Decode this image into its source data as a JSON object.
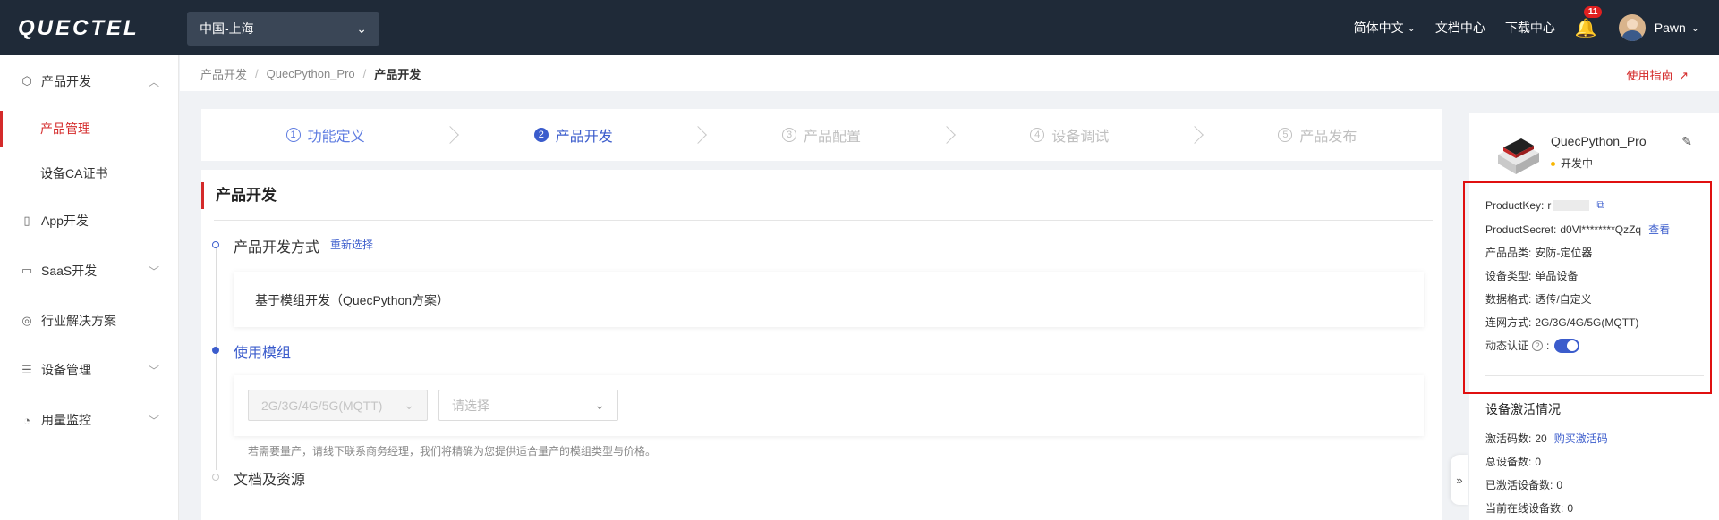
{
  "header": {
    "logo_text": "QUECTEL",
    "region": "中国-上海",
    "language": "简体中文",
    "docs": "文档中心",
    "downloads": "下载中心",
    "notification_count": "11",
    "user": "Pawn"
  },
  "sidebar": {
    "items": [
      {
        "label": "产品开发",
        "icon": "cube-icon"
      },
      {
        "label": "产品管理"
      },
      {
        "label": "设备CA证书"
      },
      {
        "label": "App开发",
        "icon": "phone-icon"
      },
      {
        "label": "SaaS开发",
        "icon": "monitor-icon"
      },
      {
        "label": "行业解决方案",
        "icon": "globe-icon"
      },
      {
        "label": "设备管理",
        "icon": "server-icon"
      },
      {
        "label": "用量监控",
        "icon": "chart-icon"
      }
    ]
  },
  "breadcrumb": {
    "items": [
      "产品开发",
      "QuecPython_Pro",
      "产品开发"
    ],
    "separator": "/",
    "guide": "使用指南"
  },
  "steps": [
    {
      "num": "1",
      "label": "功能定义"
    },
    {
      "num": "2",
      "label": "产品开发"
    },
    {
      "num": "3",
      "label": "产品配置"
    },
    {
      "num": "4",
      "label": "设备调试"
    },
    {
      "num": "5",
      "label": "产品发布"
    }
  ],
  "main": {
    "title": "产品开发",
    "dev_method_label": "产品开发方式",
    "reselect": "重新选择",
    "dev_method_value": "基于模组开发（QuecPython方案）",
    "module_label": "使用模组",
    "network_select": "2G/3G/4G/5G(MQTT)",
    "module_placeholder": "请选择",
    "hint": "若需要量产，请线下联系商务经理，我们将精确为您提供适合量产的模组类型与价格。",
    "docs_label": "文档及资源"
  },
  "product": {
    "name": "QuecPython_Pro",
    "status": "开发中",
    "product_key_label": "ProductKey:",
    "product_key_prefix": "r",
    "product_secret_label": "ProductSecret:",
    "product_secret": "d0Vl********QzZq",
    "view": "查看",
    "category_label": "产品品类:",
    "category": "安防-定位器",
    "device_type_label": "设备类型:",
    "device_type": "单品设备",
    "data_format_label": "数据格式:",
    "data_format": "透传/自定义",
    "network_label": "连网方式:",
    "network": "2G/3G/4G/5G(MQTT)",
    "dynamic_auth_label": "动态认证",
    "dynamic_auth_colon": ":",
    "dynamic_auth_on": true
  },
  "activation": {
    "title": "设备激活情况",
    "codes_label": "激活码数:",
    "codes": "20",
    "buy": "购买激活码",
    "total_label": "总设备数:",
    "total": "0",
    "activated_label": "已激活设备数:",
    "activated": "0",
    "online_label": "当前在线设备数:",
    "online": "0"
  },
  "colors": {
    "topbar": "#1f2a38",
    "accent_red": "#d42a2a",
    "accent_blue": "#3b5ccc",
    "highlight_box": "#e01010"
  }
}
